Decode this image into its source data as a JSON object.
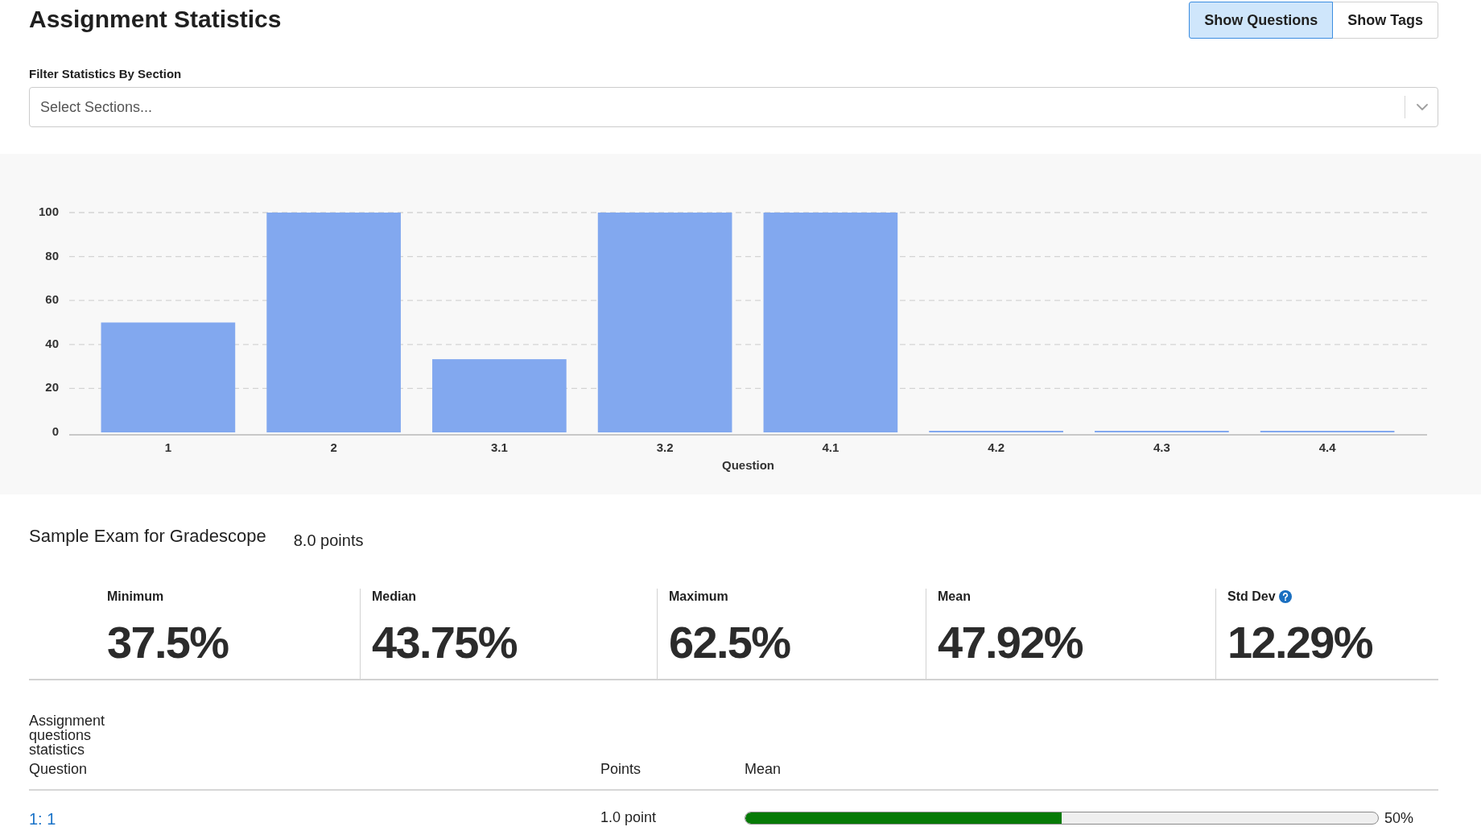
{
  "header": {
    "title": "Assignment Statistics",
    "view_toggle": [
      {
        "label": "Show Questions",
        "selected": true
      },
      {
        "label": "Show Tags",
        "selected": false
      }
    ]
  },
  "section_filter": {
    "label": "Filter Statistics By Section",
    "placeholder": "Select Sections..."
  },
  "chart": {
    "chart_data": {
      "type": "bar",
      "xlabel": "Question",
      "categories": [
        "1",
        "2",
        "3.1",
        "3.2",
        "4.1",
        "4.2",
        "4.3",
        "4.4"
      ],
      "values": [
        50,
        100,
        33.3,
        100,
        100,
        0,
        0,
        0
      ],
      "ylim": [
        0,
        100
      ],
      "yticks": [
        0,
        20,
        40,
        60,
        80,
        100
      ],
      "grid": true
    }
  },
  "assignment": {
    "name": "Sample Exam for Gradescope",
    "total_points": "8.0 points"
  },
  "summary_stats": [
    {
      "label": "Minimum",
      "value": "37.5%",
      "has_help": false
    },
    {
      "label": "Median",
      "value": "43.75%",
      "has_help": false
    },
    {
      "label": "Maximum",
      "value": "62.5%",
      "has_help": false
    },
    {
      "label": "Mean",
      "value": "47.92%",
      "has_help": false
    },
    {
      "label": "Std Dev",
      "value": "12.29%",
      "has_help": true
    }
  ],
  "questions_table": {
    "caption": "Assignment questions statistics",
    "columns": [
      "Question",
      "Points",
      "Mean"
    ],
    "rows": [
      {
        "question": "1: 1",
        "points": "1.0 point",
        "level": 0.5,
        "mean": "50%"
      }
    ]
  }
}
